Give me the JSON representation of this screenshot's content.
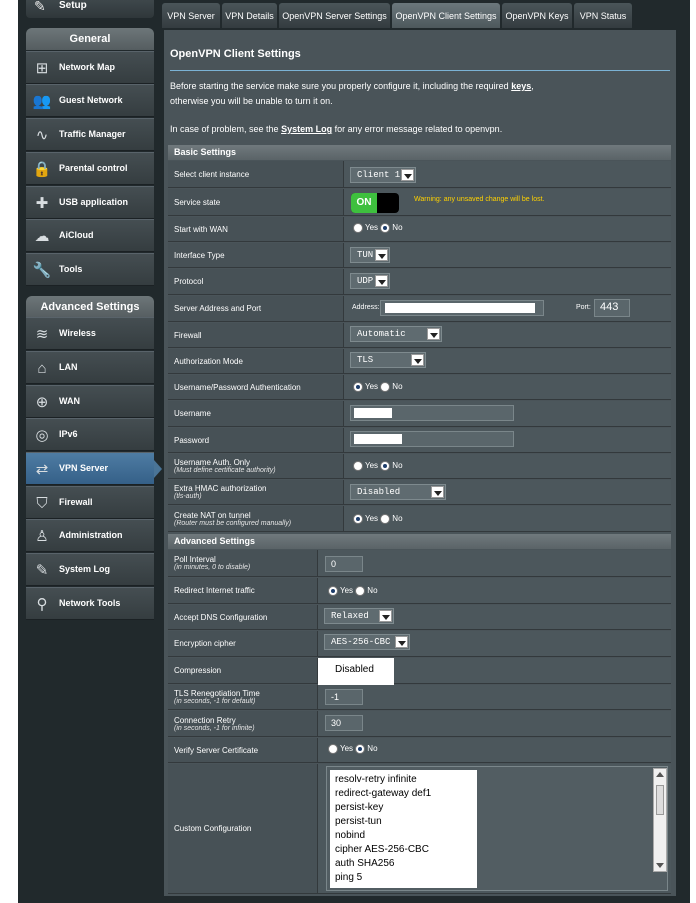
{
  "sidebar": {
    "setup_label": "Setup",
    "general_header": "General",
    "general_items": [
      {
        "label": "Network Map",
        "icon": "network-map-icon"
      },
      {
        "label": "Guest Network",
        "icon": "guest-network-icon"
      },
      {
        "label": "Traffic Manager",
        "icon": "traffic-manager-icon"
      },
      {
        "label": "Parental control",
        "icon": "lock-icon"
      },
      {
        "label": "USB application",
        "icon": "puzzle-icon"
      },
      {
        "label": "AiCloud",
        "icon": "cloud-icon"
      },
      {
        "label": "Tools",
        "icon": "wrench-icon"
      }
    ],
    "advanced_header": "Advanced Settings",
    "advanced_items": [
      {
        "label": "Wireless",
        "icon": "wifi-icon"
      },
      {
        "label": "LAN",
        "icon": "home-icon"
      },
      {
        "label": "WAN",
        "icon": "globe-icon"
      },
      {
        "label": "IPv6",
        "icon": "ipv6-icon"
      },
      {
        "label": "VPN Server",
        "icon": "vpn-icon",
        "active": true
      },
      {
        "label": "Firewall",
        "icon": "shield-icon"
      },
      {
        "label": "Administration",
        "icon": "user-icon"
      },
      {
        "label": "System Log",
        "icon": "edit-icon"
      },
      {
        "label": "Network Tools",
        "icon": "search-icon"
      }
    ]
  },
  "tabs": [
    "VPN Server",
    "VPN Details",
    "OpenVPN Server Settings",
    "OpenVPN Client Settings",
    "OpenVPN Keys",
    "VPN Status"
  ],
  "active_tab": "OpenVPN Client Settings",
  "page": {
    "title": "OpenVPN Client Settings",
    "intro_1_before": "Before starting the service make sure you properly configure it, including the required ",
    "intro_1_link": "keys",
    "intro_1_after": ",",
    "intro_2": "otherwise you will be unable to turn it on.",
    "intro_3_before": "In case of problem, see the ",
    "intro_3_link": "System Log",
    "intro_3_after": " for any error message related to openvpn."
  },
  "basic": {
    "header": "Basic Settings",
    "select_client_label": "Select client instance",
    "select_client_value": "Client 1",
    "service_state_label": "Service state",
    "service_state_value": "ON",
    "service_state_warning": "Warning: any unsaved change will be lost.",
    "start_wan_label": "Start with WAN",
    "yes": "Yes",
    "no": "No",
    "interface_type_label": "Interface Type",
    "interface_type_value": "TUN",
    "protocol_label": "Protocol",
    "protocol_value": "UDP",
    "server_address_label": "Server Address and Port",
    "address_label": "Address:",
    "port_label": "Port:",
    "port_value": "443",
    "firewall_label": "Firewall",
    "firewall_value": "Automatic",
    "auth_mode_label": "Authorization Mode",
    "auth_mode_value": "TLS",
    "userpass_auth_label": "Username/Password Authentication",
    "username_label": "Username",
    "password_label": "Password",
    "username_auth_only_label": "Username Auth. Only",
    "username_auth_only_note": "(Must define certificate authority)",
    "extra_hmac_label": "Extra HMAC authorization",
    "extra_hmac_note": "(tls-auth)",
    "extra_hmac_value": "Disabled",
    "create_nat_label": "Create NAT on tunnel",
    "create_nat_note": "(Router must be configured manually)"
  },
  "advanced": {
    "header": "Advanced Settings",
    "poll_interval_label": "Poll Interval",
    "poll_interval_note": "(in minutes, 0 to disable)",
    "poll_interval_value": "0",
    "redirect_label": "Redirect Internet traffic",
    "accept_dns_label": "Accept DNS Configuration",
    "accept_dns_value": "Relaxed",
    "cipher_label": "Encryption cipher",
    "cipher_value": "AES-256-CBC",
    "compression_label": "Compression",
    "compression_value": "Disabled",
    "tls_reneg_label": "TLS Renegotiation Time",
    "tls_reneg_note": "(in seconds, -1 for default)",
    "tls_reneg_value": "-1",
    "conn_retry_label": "Connection Retry",
    "conn_retry_note": "(in seconds, -1 for infinite)",
    "conn_retry_value": "30",
    "verify_cert_label": "Verify Server Certificate",
    "custom_config_label": "Custom Configuration",
    "custom_config_lines": [
      "resolv-retry infinite",
      "redirect-gateway def1",
      "persist-key",
      "persist-tun",
      "nobind",
      "cipher AES-256-CBC",
      "auth SHA256",
      "ping 5"
    ]
  },
  "colors": {
    "accent": "#4e7ca3",
    "toggle_on": "#3ec03e",
    "warning": "#ffd200",
    "panel": "#4a5459"
  }
}
